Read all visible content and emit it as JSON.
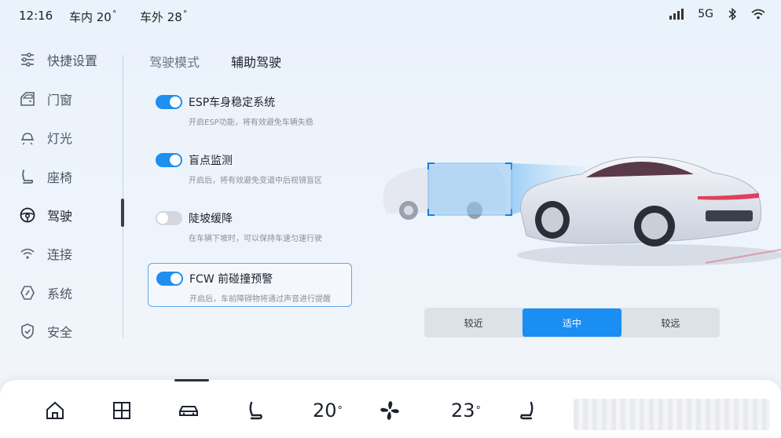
{
  "status": {
    "time": "12:16",
    "temp_in_label": "车内 20",
    "temp_out_label": "车外 28",
    "network": "5G"
  },
  "sidebar": {
    "items": [
      {
        "label": "快捷设置",
        "icon": "sliders-icon"
      },
      {
        "label": "门窗",
        "icon": "door-window-icon"
      },
      {
        "label": "灯光",
        "icon": "light-icon"
      },
      {
        "label": "座椅",
        "icon": "seat-icon"
      },
      {
        "label": "驾驶",
        "icon": "steering-wheel-icon"
      },
      {
        "label": "连接",
        "icon": "wifi-icon"
      },
      {
        "label": "系统",
        "icon": "system-icon"
      },
      {
        "label": "安全",
        "icon": "shield-icon"
      }
    ],
    "active_index": 4
  },
  "tabs": [
    {
      "label": "驾驶模式",
      "active": false
    },
    {
      "label": "辅助驾驶",
      "active": true
    }
  ],
  "settings": [
    {
      "title": "ESP车身稳定系统",
      "desc": "开启ESP功能，将有效避免车辆失稳",
      "on": true
    },
    {
      "title": "盲点监测",
      "desc": "开启后，将有效避免变道中后视镜盲区",
      "on": true
    },
    {
      "title": "陡坡缓降",
      "desc": "在车辆下坡时，可以保持车速匀速行驶",
      "on": false
    },
    {
      "title": "FCW 前碰撞预警",
      "desc": "开启后，车前障碍物将通过声音进行提醒",
      "on": true
    }
  ],
  "distance": {
    "options": [
      "较近",
      "适中",
      "较远"
    ],
    "selected": "适中"
  },
  "dock": {
    "temp_left": "20",
    "temp_right": "23",
    "accent_color": "#1a8ef2"
  }
}
